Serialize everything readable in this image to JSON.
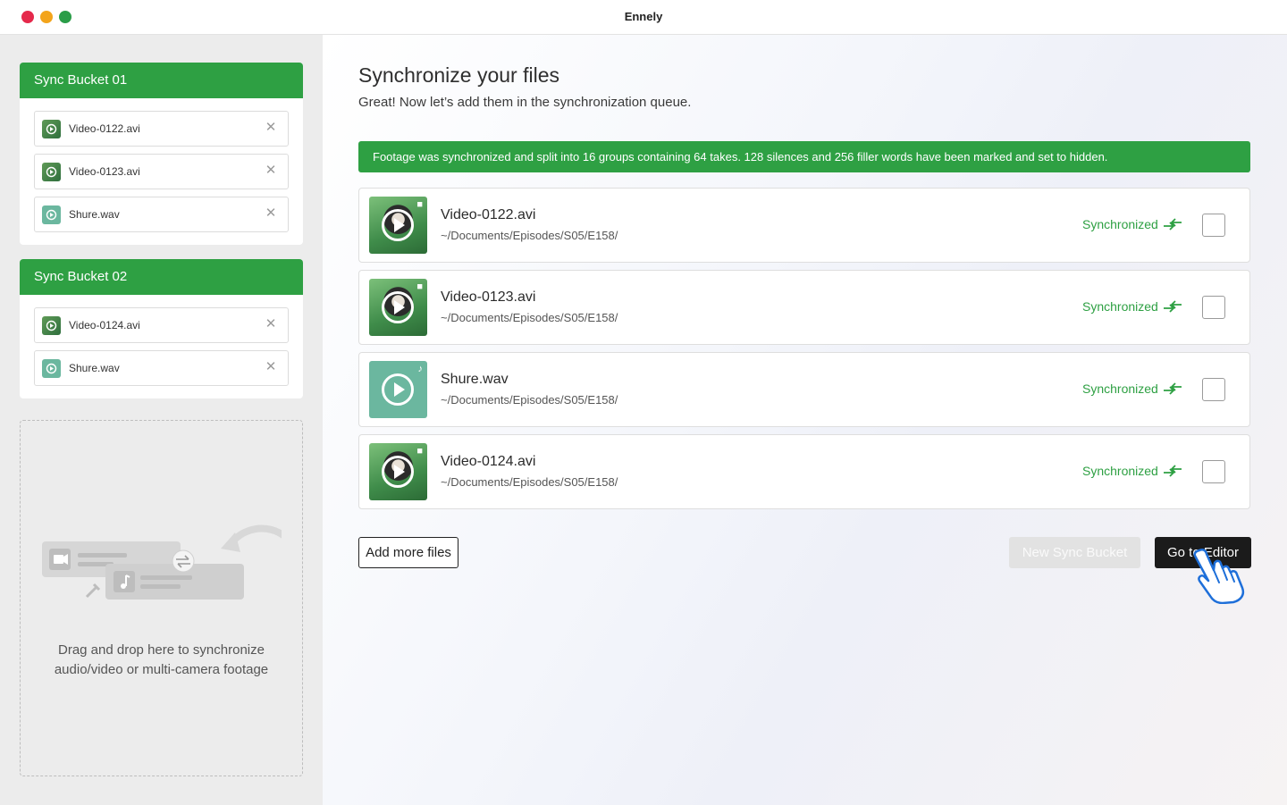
{
  "window": {
    "title": "Ennely"
  },
  "sidebar": {
    "buckets": [
      {
        "title": "Sync Bucket 01",
        "files": [
          {
            "name": "Video-0122.avi",
            "type": "video"
          },
          {
            "name": "Video-0123.avi",
            "type": "video"
          },
          {
            "name": "Shure.wav",
            "type": "audio"
          }
        ]
      },
      {
        "title": "Sync Bucket 02",
        "files": [
          {
            "name": "Video-0124.avi",
            "type": "video"
          },
          {
            "name": "Shure.wav",
            "type": "audio"
          }
        ]
      }
    ],
    "dropzone": {
      "line1": "Drag and drop here to synchronize",
      "line2": "audio/video or multi-camera footage"
    }
  },
  "main": {
    "title": "Synchronize your files",
    "subtitle": "Great! Now let’s add them in the synchronization queue.",
    "banner": "Footage was synchronized and split into 16 groups containing 64 takes. 128 silences and 256 filler words have been marked and set to hidden.",
    "queue": [
      {
        "name": "Video-0122.avi",
        "path": "~/Documents/Episodes/S05/E158/",
        "status": "Synchronized",
        "type": "video",
        "checked": false
      },
      {
        "name": "Video-0123.avi",
        "path": "~/Documents/Episodes/S05/E158/",
        "status": "Synchronized",
        "type": "video",
        "checked": false
      },
      {
        "name": "Shure.wav",
        "path": "~/Documents/Episodes/S05/E158/",
        "status": "Synchronized",
        "type": "audio",
        "checked": false
      },
      {
        "name": "Video-0124.avi",
        "path": "~/Documents/Episodes/S05/E158/",
        "status": "Synchronized",
        "type": "video",
        "checked": false
      }
    ],
    "buttons": {
      "add_more": "Add more files",
      "new_bucket": "New Sync Bucket",
      "go_editor": "Go to Editor"
    }
  },
  "colors": {
    "accent_green": "#2ea043",
    "dark_button": "#1b1b1b"
  },
  "icons": {
    "video_corner": "video-camera-icon",
    "audio_corner": "music-note-icon",
    "sync": "sync-arrows-icon",
    "remove": "close-icon",
    "pointer": "hand-pointer-icon"
  }
}
